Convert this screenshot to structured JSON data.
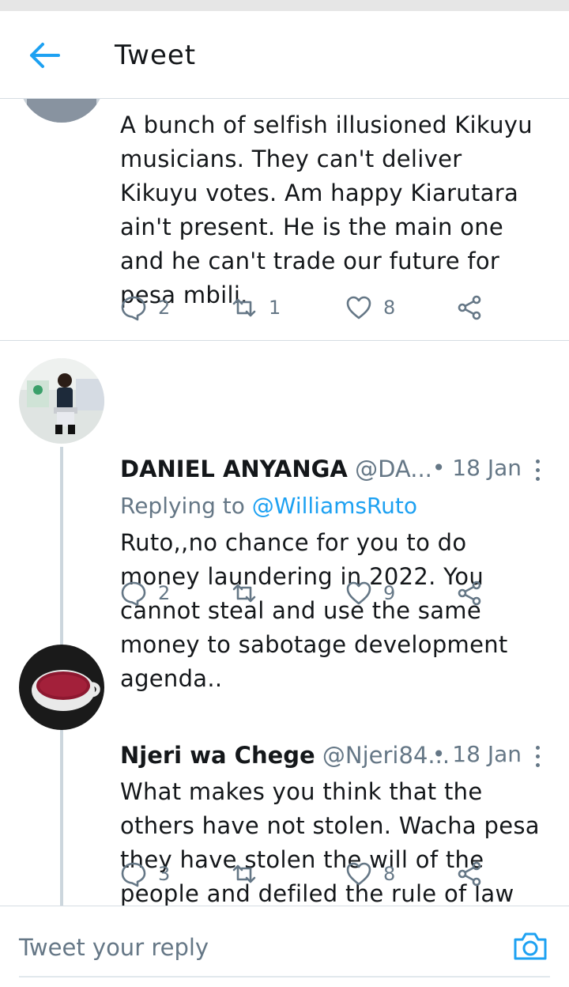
{
  "header": {
    "title": "Tweet"
  },
  "tweets": [
    {
      "text": "A bunch of selfish illusioned Kikuyu musicians. They can't deliver Kikuyu votes. Am happy Kiarutara ain't present. He is the main one and he can't trade our future for pesa mbili.",
      "replies": "2",
      "retweets": "1",
      "likes": "8"
    },
    {
      "name": "DANIEL ANYANGA",
      "handle": "@DA...",
      "date": "• 18 Jan",
      "replying_prefix": "Replying to",
      "replying_to": "@WilliamsRuto",
      "text": "Ruto,,no chance for you to do money laundering in 2022. You cannot steal and use the same money to sabotage development agenda..",
      "replies": "2",
      "retweets": "",
      "likes": "9"
    },
    {
      "name": "Njeri wa Chege",
      "handle": "@Njeri84...",
      "date": "• 18 Jan",
      "text": "What makes you think that the others have not stolen. Wacha pesa they have stolen the will of the people and defiled the rule of law that is the worst robbery",
      "replies": "3",
      "retweets": "",
      "likes": "8"
    }
  ],
  "reply_bar": {
    "placeholder": "Tweet your reply"
  },
  "colors": {
    "accent": "#1da1f2",
    "secondary_text": "#657786",
    "divider": "#d6dde3"
  }
}
